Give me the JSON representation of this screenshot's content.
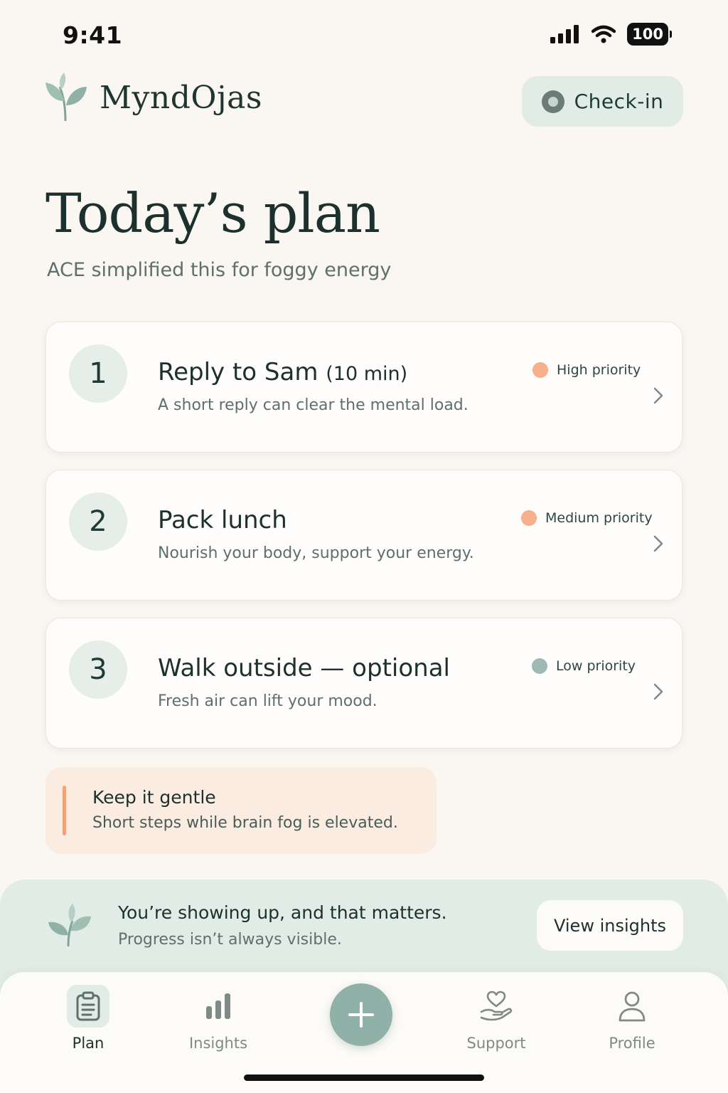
{
  "status_bar": {
    "time": "9:41",
    "battery": "100"
  },
  "header": {
    "app_name": "MyndOjas",
    "checkin_label": "Check-in"
  },
  "page": {
    "title": "Today’s plan",
    "subtitle": "ACE simplified this for foggy energy"
  },
  "tasks": [
    {
      "number": "1",
      "title": "Reply to Sam",
      "duration": "(10 min)",
      "description": "A short reply can clear the mental load.",
      "priority": "High priority",
      "priority_color": "#f6b08c"
    },
    {
      "number": "2",
      "title": "Pack lunch",
      "duration": "",
      "description": "Nourish your body, support your energy.",
      "priority": "Medium priority",
      "priority_color": "#f6b08c"
    },
    {
      "number": "3",
      "title": "Walk outside — optional",
      "duration": "",
      "description": "Fresh air can lift your mood.",
      "priority": "Low priority",
      "priority_color": "#9fbab2"
    }
  ],
  "gentle_note": {
    "title": "Keep it gentle",
    "text": "Short steps while brain fog is elevated."
  },
  "encouragement": {
    "title": "You’re showing up, and that matters.",
    "text": "Progress isn’t always visible.",
    "button_label": "View insights"
  },
  "nav": {
    "items": [
      {
        "label": "Plan",
        "icon": "clipboard-icon",
        "active": true
      },
      {
        "label": "Insights",
        "icon": "bar-chart-icon",
        "active": false
      },
      {
        "label": "Support",
        "icon": "heart-hand-icon",
        "active": false
      },
      {
        "label": "Profile",
        "icon": "person-icon",
        "active": false
      }
    ],
    "fab_icon": "plus-icon"
  },
  "colors": {
    "accent": "#8fb1a7",
    "mint": "#e2ece7",
    "background": "#faf7f3",
    "peach": "#f6b08c"
  }
}
